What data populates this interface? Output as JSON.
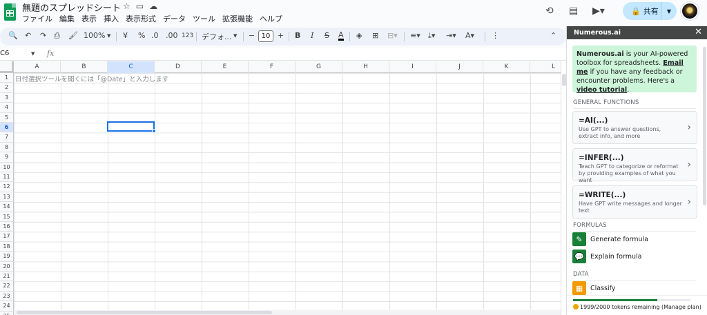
{
  "doc": {
    "title": "無題のスプレッドシート",
    "menu": [
      "ファイル",
      "編集",
      "表示",
      "挿入",
      "表示形式",
      "データ",
      "ツール",
      "拡張機能",
      "ヘルプ"
    ],
    "share_label": "共有"
  },
  "toolbar": {
    "zoom": "100%",
    "currency": "¥",
    "percent": "%",
    "dec_decrease": ".0",
    "dec_increase": ".00",
    "number_format": "123",
    "font": "デフォ...",
    "font_size": "10"
  },
  "formula_bar": {
    "cell_ref": "C6",
    "fx": "fx"
  },
  "grid": {
    "columns": [
      "A",
      "B",
      "C",
      "D",
      "E",
      "F",
      "G",
      "H",
      "I",
      "J",
      "K",
      "L"
    ],
    "selected_column": "C",
    "rows": [
      "1",
      "2",
      "3",
      "4",
      "5",
      "6",
      "7",
      "8",
      "9",
      "10",
      "11",
      "12",
      "13",
      "14",
      "15",
      "16",
      "17",
      "18",
      "19",
      "20",
      "21",
      "22",
      "23",
      "24",
      "25"
    ],
    "selected_row": "6",
    "hint": "日付選択ツールを開くには「@Date」と入力します"
  },
  "panel": {
    "title": "Numerous.ai",
    "intro_brand": "Numerous.ai",
    "intro_text1": " is your AI-powered toolbox for spreadsheets. ",
    "intro_email": "Email me",
    "intro_text2": " if you have any feedback or encounter problems. Here's a ",
    "intro_video": "video tutorial",
    "intro_end": ".",
    "general_label": "GENERAL FUNCTIONS",
    "functions": [
      {
        "name": "=AI(...)",
        "desc": "Use GPT to answer questions, extract info, and more"
      },
      {
        "name": "=INFER(...)",
        "desc": "Teach GPT to categorize or reformat by providing examples of what you want"
      },
      {
        "name": "=WRITE(...)",
        "desc": "Have GPT write messages and longer text"
      }
    ],
    "formulas_label": "FORMULAS",
    "generate_formula": "Generate formula",
    "explain_formula": "Explain formula",
    "data_label": "DATA",
    "classify": "Classify",
    "tokens_text": "1999/2000 tokens remaining (Manage plan)",
    "tokens_fraction": 0.72
  },
  "icons": {
    "history": "history-icon",
    "comments": "comment-icon",
    "meet": "video-icon",
    "lock": "lock-icon"
  }
}
